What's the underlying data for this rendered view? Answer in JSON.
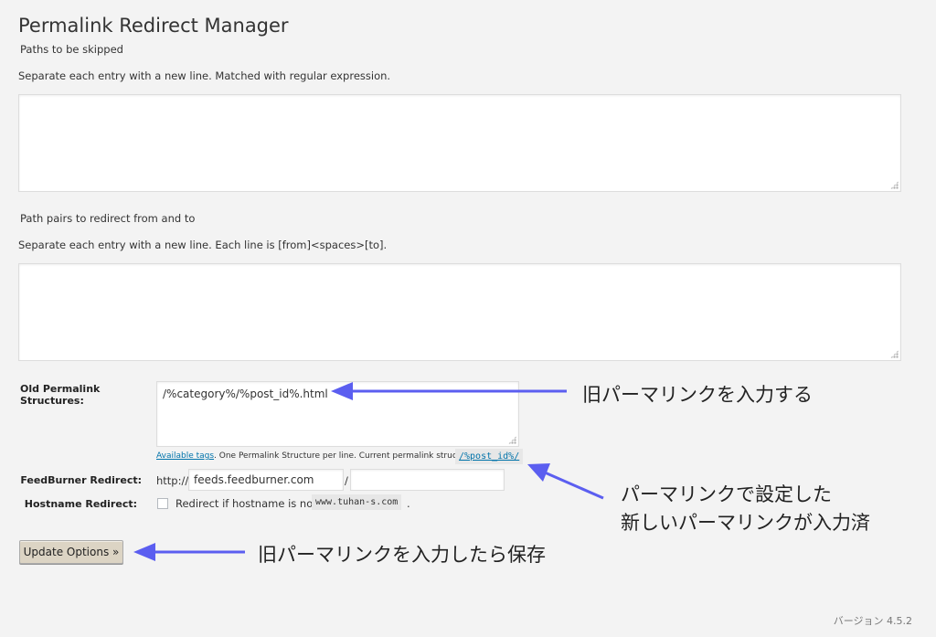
{
  "page": {
    "title": "Permalink Redirect Manager",
    "version": "バージョン 4.5.2"
  },
  "skip_paths": {
    "heading": "Paths to be skipped",
    "description": "Separate each entry with a new line. Matched with regular expression.",
    "value": ""
  },
  "redirect_pairs": {
    "heading": "Path pairs to redirect from and to",
    "description": "Separate each entry with a new line. Each line is [from]<spaces>[to].",
    "value": ""
  },
  "old_permalink": {
    "label": "Old Permalink Structures:",
    "value": "/%category%/%post_id%.html",
    "help_link": "Available tags",
    "help_text": ". One Permalink Structure per line. Current permalink structure:",
    "current_structure": "/%post_id%/"
  },
  "feedburner": {
    "label": "FeedBurner Redirect:",
    "prefix": "http://",
    "host_value": "feeds.feedburner.com",
    "separator": "/",
    "path_value": ""
  },
  "hostname": {
    "label": "Hostname Redirect:",
    "checkbox_text": "Redirect if hostname is not",
    "hostname": "www.tuhan-s.com",
    "suffix": "."
  },
  "update_button": {
    "label": "Update Options »"
  },
  "annotations": {
    "old_permalink_note": "旧パーマリンクを入力する",
    "current_structure_note_line1": "パーマリンクで設定した",
    "current_structure_note_line2": "新しいパーマリンクが入力済",
    "save_note": "旧パーマリンクを入力したら保存"
  },
  "colors": {
    "arrow": "#5b5ef0",
    "link": "#0073aa",
    "background": "#f3f3f3"
  }
}
